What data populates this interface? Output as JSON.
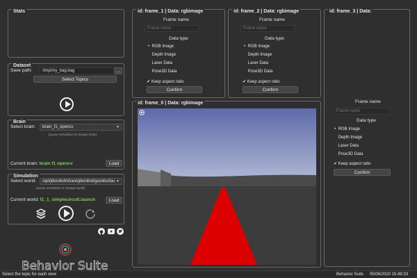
{
  "stats": {
    "title": "Stats"
  },
  "dataset": {
    "title": "Dataset",
    "save_path_label": "Save path:",
    "save_path_value": "/tmp/my_bag.bag",
    "browse_label": "...",
    "select_topics_label": "Select Topics"
  },
  "brain": {
    "title": "Brain",
    "select_label": "Select brain:",
    "selected": "brain_f1_opencv",
    "hint": "(pause simulation to change brain)",
    "current_label": "Current brain:",
    "current_value": "brain f1 opencv",
    "load_label": "Load"
  },
  "simulation": {
    "title": "Simulation",
    "select_label": "Select world:",
    "selected": "/opt/jderobot/share/jderobot/gazebo/lau",
    "hint": "(pause simulation to change world)",
    "current_label": "Current world:",
    "current_value": "f1_1_simplecircuit.launch",
    "load_label": "Load"
  },
  "logo_text": "Behavior Suite",
  "frame_config": {
    "frame_name_label": "Frame name",
    "frame_name_placeholder": "Frame name",
    "data_type_label": "Data type",
    "options": [
      "RGB Image",
      "Depth Image",
      "Laser Data",
      "Pose3D Data"
    ],
    "keep_aspect_label": "Keep aspect ratio",
    "confirm_label": "Confirm"
  },
  "frames": {
    "frame_1_title": "id: frame_1 | Data: rgbimage",
    "frame_2_title": "id: frame_2 | Data: rgbimage",
    "frame_3_title": "id: frame_3 | Data:",
    "frame_0_title": "id: frame_0 | Data: rgbimage"
  },
  "statusbar": {
    "message": "Select the topic for each view",
    "app_name": "Behavior Suite",
    "datetime": "05/06/2020 15:48:33"
  },
  "colors": {
    "background": "#2f2f2f",
    "accent_green": "#7cd35a",
    "track_red": "#dd0000",
    "sky_top": "#5d6aa8",
    "sky_bottom": "#b8bed8"
  },
  "icons": [
    "github-icon",
    "youtube-icon",
    "twitter-icon",
    "gear-icon",
    "gazebo-icon",
    "reset-icon",
    "logo-icon"
  ]
}
